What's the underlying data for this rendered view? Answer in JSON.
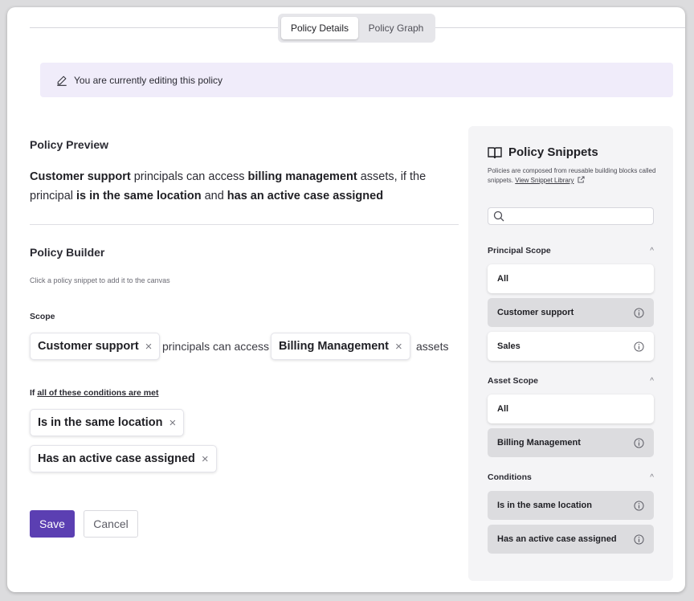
{
  "tabs": [
    {
      "label": "Policy Details",
      "active": true
    },
    {
      "label": "Policy Graph",
      "active": false
    }
  ],
  "banner": {
    "text": "You are currently editing this policy",
    "icon": "pencil-icon"
  },
  "preview": {
    "title": "Policy Preview",
    "principal": "Customer support",
    "t1": " principals can access ",
    "asset": "billing management",
    "t2": " assets, if the principal ",
    "cond1": "is in the same location",
    "t3": " and ",
    "cond2": "has an active case assigned"
  },
  "builder": {
    "title": "Policy Builder",
    "hint": "Click a policy snippet to add it to the canvas",
    "scope_label": "Scope",
    "principal_chip": "Customer support",
    "mid_text": "principals can access",
    "asset_chip": "Billing Management",
    "end_text": "assets",
    "cond_prefix": "If ",
    "cond_link": "all of these conditions are met",
    "conditions": [
      "Is in the same location",
      "Has an active case assigned"
    ],
    "remove_glyph": "×"
  },
  "actions": {
    "save": "Save",
    "cancel": "Cancel"
  },
  "snippets": {
    "title": "Policy Snippets",
    "desc": "Policies are composed from reusable building blocks called snippets. ",
    "link": "View Snippet Library",
    "search_placeholder": "",
    "sections": [
      {
        "title": "Principal Scope",
        "items": [
          "All",
          "Customer support",
          "Sales"
        ]
      },
      {
        "title": "Asset Scope",
        "items": [
          "All",
          "Billing Management"
        ]
      },
      {
        "title": "Conditions",
        "items": [
          "Is in the same location",
          "Has an active case assigned"
        ]
      }
    ],
    "chevron": "^"
  },
  "colors": {
    "accent": "#5b3fb2",
    "banner_bg": "#f0ecfa",
    "panel_bg": "#f4f4f6",
    "selected_snippet": "#dcdcdf"
  }
}
